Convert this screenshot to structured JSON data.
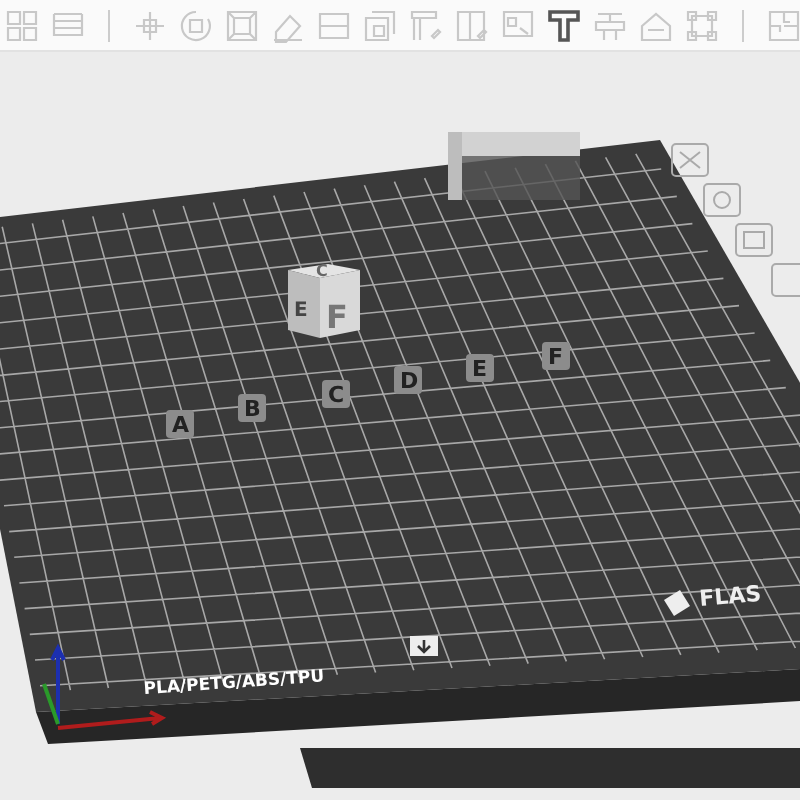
{
  "toolbar": {
    "tools": [
      {
        "kind": "layout",
        "selected": false
      },
      {
        "kind": "list",
        "selected": false
      },
      {
        "kind": "separator"
      },
      {
        "kind": "move",
        "selected": false
      },
      {
        "kind": "rotate",
        "selected": false
      },
      {
        "kind": "scale",
        "selected": false
      },
      {
        "kind": "eraser",
        "selected": false
      },
      {
        "kind": "cut",
        "selected": false
      },
      {
        "kind": "hollow",
        "selected": false
      },
      {
        "kind": "support",
        "selected": false
      },
      {
        "kind": "support-edit",
        "selected": false
      },
      {
        "kind": "image",
        "selected": false
      },
      {
        "kind": "text",
        "selected": true
      },
      {
        "kind": "stamp",
        "selected": false
      },
      {
        "kind": "house",
        "selected": false
      },
      {
        "kind": "frame",
        "selected": false
      },
      {
        "kind": "separator"
      },
      {
        "kind": "puzzle",
        "selected": false
      }
    ]
  },
  "build_plate": {
    "material_label": "PLA/PETG/ABS/TPU",
    "brand": "FLAS",
    "models": {
      "letters": [
        "A",
        "B",
        "C",
        "D",
        "E",
        "F"
      ],
      "cube_front": "F",
      "cube_side": "E",
      "cube_top": "C"
    }
  }
}
